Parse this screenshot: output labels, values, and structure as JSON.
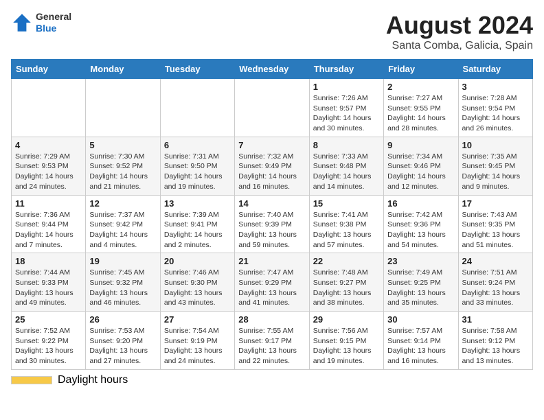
{
  "header": {
    "logo_general": "General",
    "logo_blue": "Blue",
    "title": "August 2024",
    "subtitle": "Santa Comba, Galicia, Spain"
  },
  "days_of_week": [
    "Sunday",
    "Monday",
    "Tuesday",
    "Wednesday",
    "Thursday",
    "Friday",
    "Saturday"
  ],
  "weeks": [
    [
      {
        "day": "",
        "info": ""
      },
      {
        "day": "",
        "info": ""
      },
      {
        "day": "",
        "info": ""
      },
      {
        "day": "",
        "info": ""
      },
      {
        "day": "1",
        "info": "Sunrise: 7:26 AM\nSunset: 9:57 PM\nDaylight: 14 hours\nand 30 minutes."
      },
      {
        "day": "2",
        "info": "Sunrise: 7:27 AM\nSunset: 9:55 PM\nDaylight: 14 hours\nand 28 minutes."
      },
      {
        "day": "3",
        "info": "Sunrise: 7:28 AM\nSunset: 9:54 PM\nDaylight: 14 hours\nand 26 minutes."
      }
    ],
    [
      {
        "day": "4",
        "info": "Sunrise: 7:29 AM\nSunset: 9:53 PM\nDaylight: 14 hours\nand 24 minutes."
      },
      {
        "day": "5",
        "info": "Sunrise: 7:30 AM\nSunset: 9:52 PM\nDaylight: 14 hours\nand 21 minutes."
      },
      {
        "day": "6",
        "info": "Sunrise: 7:31 AM\nSunset: 9:50 PM\nDaylight: 14 hours\nand 19 minutes."
      },
      {
        "day": "7",
        "info": "Sunrise: 7:32 AM\nSunset: 9:49 PM\nDaylight: 14 hours\nand 16 minutes."
      },
      {
        "day": "8",
        "info": "Sunrise: 7:33 AM\nSunset: 9:48 PM\nDaylight: 14 hours\nand 14 minutes."
      },
      {
        "day": "9",
        "info": "Sunrise: 7:34 AM\nSunset: 9:46 PM\nDaylight: 14 hours\nand 12 minutes."
      },
      {
        "day": "10",
        "info": "Sunrise: 7:35 AM\nSunset: 9:45 PM\nDaylight: 14 hours\nand 9 minutes."
      }
    ],
    [
      {
        "day": "11",
        "info": "Sunrise: 7:36 AM\nSunset: 9:44 PM\nDaylight: 14 hours\nand 7 minutes."
      },
      {
        "day": "12",
        "info": "Sunrise: 7:37 AM\nSunset: 9:42 PM\nDaylight: 14 hours\nand 4 minutes."
      },
      {
        "day": "13",
        "info": "Sunrise: 7:39 AM\nSunset: 9:41 PM\nDaylight: 14 hours\nand 2 minutes."
      },
      {
        "day": "14",
        "info": "Sunrise: 7:40 AM\nSunset: 9:39 PM\nDaylight: 13 hours\nand 59 minutes."
      },
      {
        "day": "15",
        "info": "Sunrise: 7:41 AM\nSunset: 9:38 PM\nDaylight: 13 hours\nand 57 minutes."
      },
      {
        "day": "16",
        "info": "Sunrise: 7:42 AM\nSunset: 9:36 PM\nDaylight: 13 hours\nand 54 minutes."
      },
      {
        "day": "17",
        "info": "Sunrise: 7:43 AM\nSunset: 9:35 PM\nDaylight: 13 hours\nand 51 minutes."
      }
    ],
    [
      {
        "day": "18",
        "info": "Sunrise: 7:44 AM\nSunset: 9:33 PM\nDaylight: 13 hours\nand 49 minutes."
      },
      {
        "day": "19",
        "info": "Sunrise: 7:45 AM\nSunset: 9:32 PM\nDaylight: 13 hours\nand 46 minutes."
      },
      {
        "day": "20",
        "info": "Sunrise: 7:46 AM\nSunset: 9:30 PM\nDaylight: 13 hours\nand 43 minutes."
      },
      {
        "day": "21",
        "info": "Sunrise: 7:47 AM\nSunset: 9:29 PM\nDaylight: 13 hours\nand 41 minutes."
      },
      {
        "day": "22",
        "info": "Sunrise: 7:48 AM\nSunset: 9:27 PM\nDaylight: 13 hours\nand 38 minutes."
      },
      {
        "day": "23",
        "info": "Sunrise: 7:49 AM\nSunset: 9:25 PM\nDaylight: 13 hours\nand 35 minutes."
      },
      {
        "day": "24",
        "info": "Sunrise: 7:51 AM\nSunset: 9:24 PM\nDaylight: 13 hours\nand 33 minutes."
      }
    ],
    [
      {
        "day": "25",
        "info": "Sunrise: 7:52 AM\nSunset: 9:22 PM\nDaylight: 13 hours\nand 30 minutes."
      },
      {
        "day": "26",
        "info": "Sunrise: 7:53 AM\nSunset: 9:20 PM\nDaylight: 13 hours\nand 27 minutes."
      },
      {
        "day": "27",
        "info": "Sunrise: 7:54 AM\nSunset: 9:19 PM\nDaylight: 13 hours\nand 24 minutes."
      },
      {
        "day": "28",
        "info": "Sunrise: 7:55 AM\nSunset: 9:17 PM\nDaylight: 13 hours\nand 22 minutes."
      },
      {
        "day": "29",
        "info": "Sunrise: 7:56 AM\nSunset: 9:15 PM\nDaylight: 13 hours\nand 19 minutes."
      },
      {
        "day": "30",
        "info": "Sunrise: 7:57 AM\nSunset: 9:14 PM\nDaylight: 13 hours\nand 16 minutes."
      },
      {
        "day": "31",
        "info": "Sunrise: 7:58 AM\nSunset: 9:12 PM\nDaylight: 13 hours\nand 13 minutes."
      }
    ]
  ],
  "footer": {
    "daylight_label": "Daylight hours"
  }
}
